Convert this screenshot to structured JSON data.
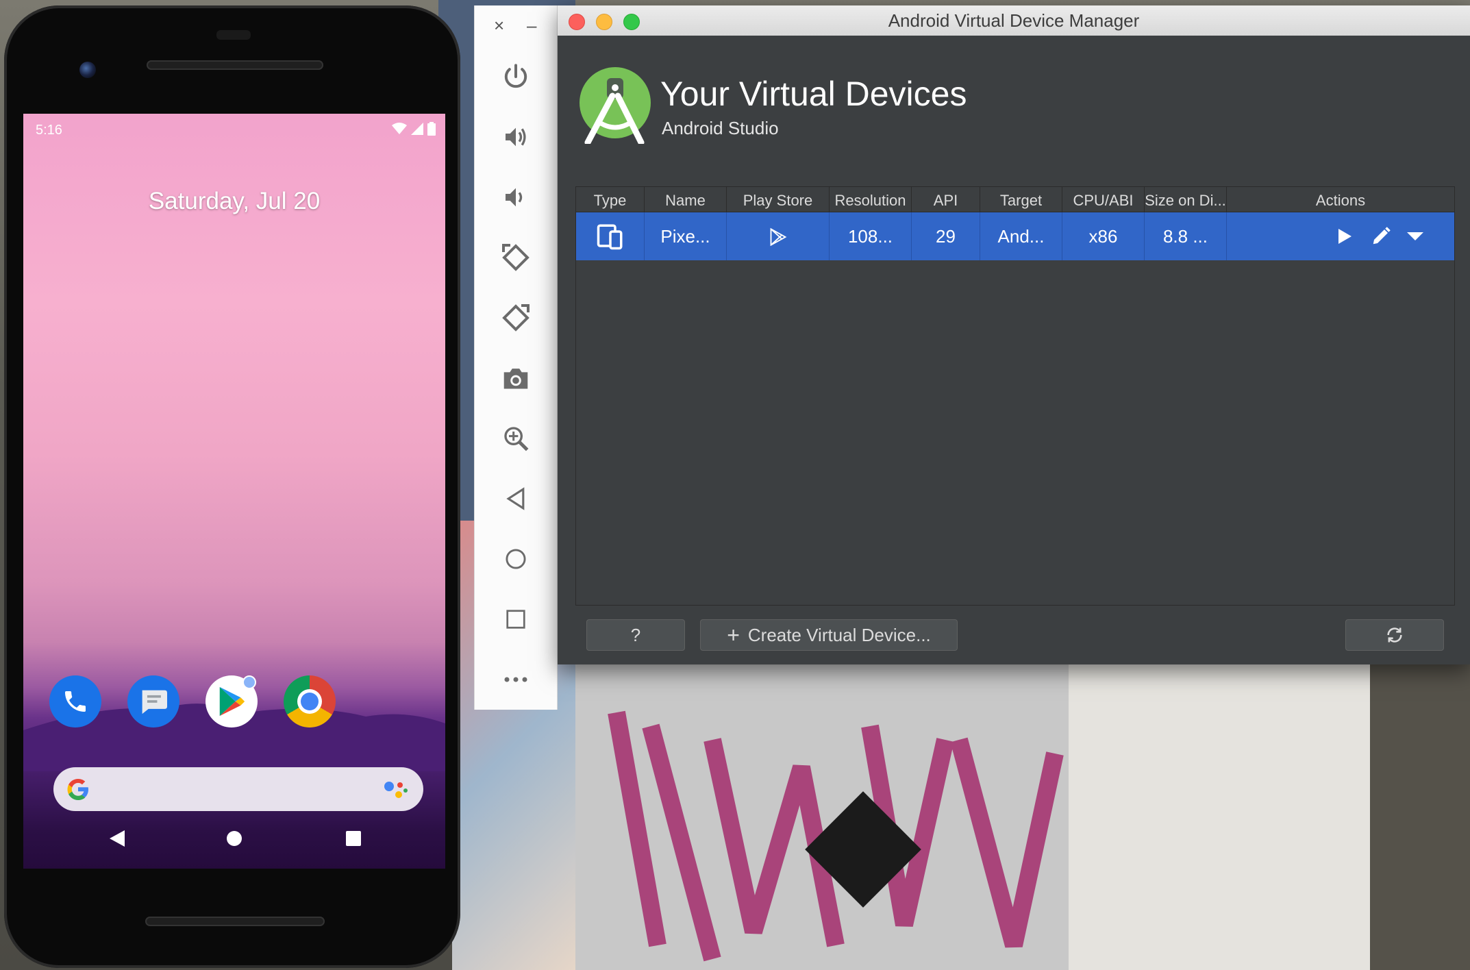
{
  "phone": {
    "time": "5:16",
    "date": "Saturday, Jul 20",
    "dock_apps": [
      "phone-app",
      "messages-app",
      "play-store-app",
      "chrome-app"
    ]
  },
  "emulator_toolbar": {
    "close_symbol": "×",
    "minimize_symbol": "–",
    "buttons": [
      "power-icon",
      "volume-up-icon",
      "volume-down-icon",
      "rotate-left-icon",
      "rotate-right-icon",
      "camera-icon",
      "zoom-icon",
      "back-icon",
      "home-icon",
      "overview-icon",
      "more-icon"
    ]
  },
  "avd_manager": {
    "window_title": "Android Virtual Device Manager",
    "heading": "Your Virtual Devices",
    "subheading": "Android Studio",
    "columns": [
      "Type",
      "Name",
      "Play Store",
      "Resolution",
      "API",
      "Target",
      "CPU/ABI",
      "Size on Di...",
      "Actions"
    ],
    "rows": [
      {
        "type_icon": "phone-tablet-icon",
        "name": "Pixe...",
        "play_store_icon": "play-store-icon",
        "resolution": "108...",
        "api": "29",
        "target": "And...",
        "cpu_abi": "x86",
        "size_on_disk": "8.8 ..."
      }
    ],
    "help_label": "?",
    "create_label": "Create Virtual Device...",
    "create_plus": "+",
    "refresh_icon": "refresh-icon"
  },
  "colors": {
    "accent_selected_row": "#3166c8",
    "panel_bg": "#3c3f41"
  }
}
